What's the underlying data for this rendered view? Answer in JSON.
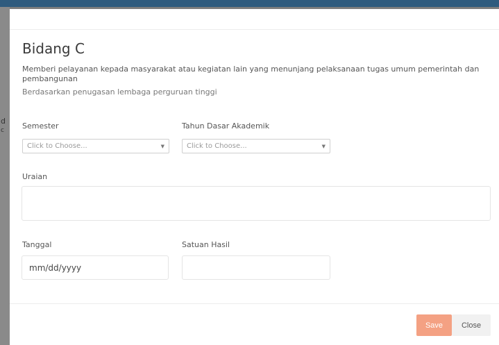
{
  "modal": {
    "title": "Bidang C",
    "description": "Memberi pelayanan kepada masyarakat atau kegiatan lain yang menunjang pelaksanaan tugas umum pemerintah dan pembangunan",
    "subdescription": "Berdasarkan penugasan lembaga perguruan tinggi"
  },
  "form": {
    "semester": {
      "label": "Semester",
      "placeholder": "Click to Choose..."
    },
    "tahun": {
      "label": "Tahun Dasar Akademik",
      "placeholder": "Click to Choose..."
    },
    "uraian": {
      "label": "Uraian",
      "value": ""
    },
    "tanggal": {
      "label": "Tanggal",
      "value": "mm/dd/yyyy"
    },
    "satuan": {
      "label": "Satuan Hasil",
      "value": ""
    }
  },
  "footer": {
    "save_label": "Save",
    "close_label": "Close"
  },
  "colors": {
    "save_button": "#f4a183",
    "top_bar": "#2f5b7e"
  }
}
